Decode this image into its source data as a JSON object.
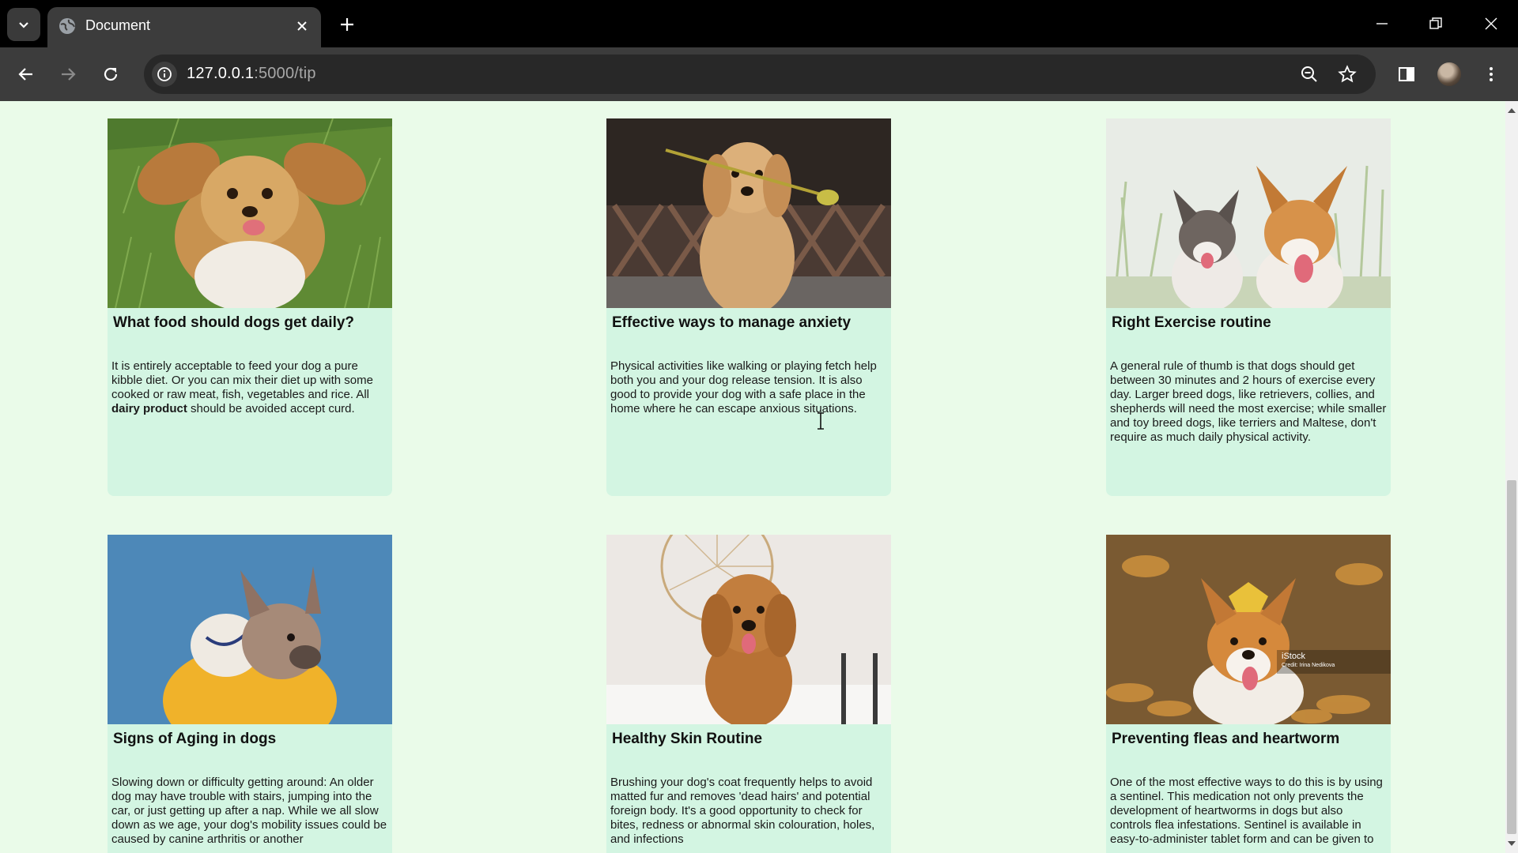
{
  "browser": {
    "tab_title": "Document",
    "url_host": "127.0.0.1",
    "url_path": ":5000/tip"
  },
  "cards": [
    {
      "title": "What food should dogs get daily?",
      "text_before": "It is entirely acceptable to feed your dog a pure kibble diet. Or you can mix their diet up with some cooked or raw meat, fish, vegetables and rice. All ",
      "bold": "dairy product",
      "text_after": " should be avoided accept curd.",
      "image": "dog-lying-in-grass"
    },
    {
      "title": "Effective ways to manage anxiety",
      "text": "Physical activities like walking or playing fetch help both you and your dog release tension. It is also good to provide your dog with a safe place in the home where he can escape anxious situations.",
      "image": "golden-retriever-with-flower"
    },
    {
      "title": "Right Exercise routine",
      "text": "A general rule of thumb is that dogs should get between 30 minutes and 2 hours of exercise every day. Larger breed dogs, like retrievers, collies, and shepherds will need the most exercise; while smaller and toy breed dogs, like terriers and Maltese, don't require as much daily physical activity.",
      "image": "two-dogs-in-meadow"
    },
    {
      "title": "Signs of Aging in dogs",
      "text": "Slowing down or difficulty getting around: An older dog may have trouble with stairs, jumping into the car, or just getting up after a nap. While we all slow down as we age, your dog's mobility issues could be caused by canine arthritis or another",
      "image": "french-bulldog-in-hoodie"
    },
    {
      "title": "Healthy Skin Routine",
      "text": "Brushing your dog's coat frequently helps to avoid matted fur and removes 'dead hairs' and potential foreign body. It's a good opportunity to check for bites, redness or abnormal skin colouration, holes, and infections",
      "image": "curly-doodle-dog"
    },
    {
      "title": "Preventing fleas and heartworm",
      "text": "One of the most effective ways to do this is by using a sentinel. This medication not only prevents the development of heartworms in dogs but also controls flea infestations. Sentinel is available in easy-to-administer tablet form and can be given to",
      "image": "corgi-in-autumn-leaves",
      "watermark": "iStock",
      "watermark_credit": "Credit: Irina Nedikova"
    }
  ]
}
